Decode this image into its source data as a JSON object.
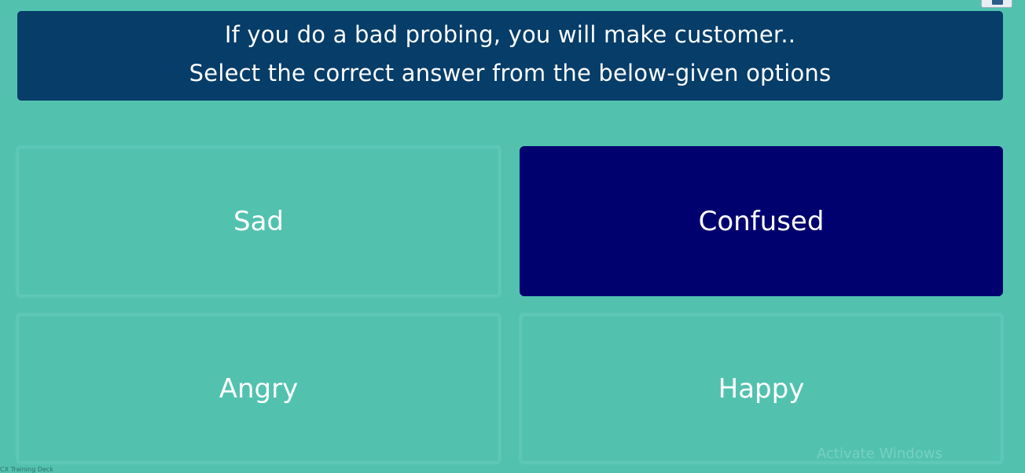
{
  "question": {
    "line1": "If you do a bad probing, you will make customer..",
    "line2": "Select the correct answer from the below-given options"
  },
  "options": [
    {
      "label": "Sad",
      "selected": false
    },
    {
      "label": "Confused",
      "selected": true
    },
    {
      "label": "Angry",
      "selected": false
    },
    {
      "label": "Happy",
      "selected": false
    }
  ],
  "watermark": "Activate Windows",
  "footer_text": "CX Training Deck",
  "colors": {
    "background": "#52c2af",
    "question_bg": "#063d69",
    "selected_bg": "#00006e",
    "text": "#ffffff"
  },
  "icons": {
    "corner": "window-icon"
  }
}
